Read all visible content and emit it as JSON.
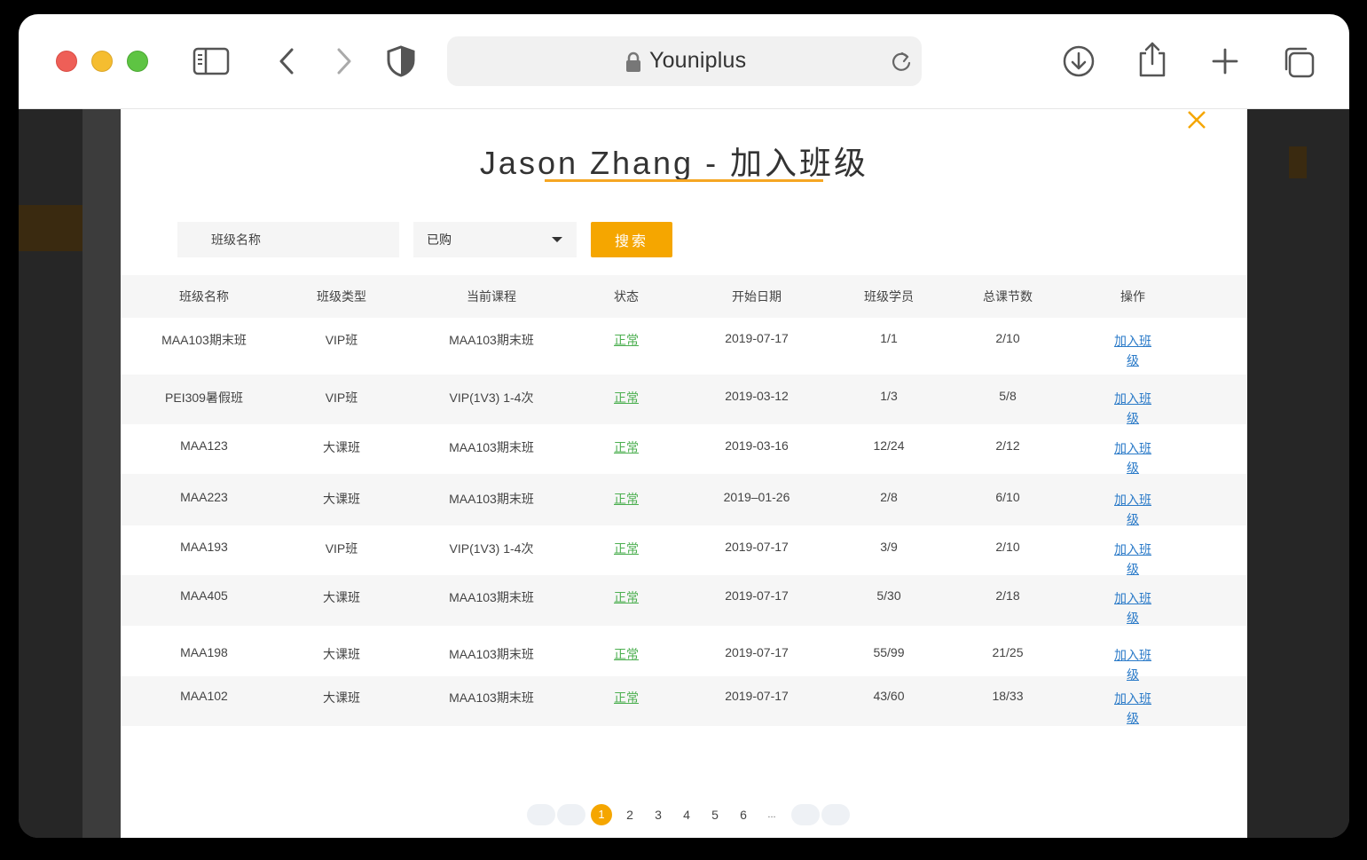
{
  "browser": {
    "address": "Youniplus"
  },
  "modal": {
    "title": "Jason Zhang - 加入班级",
    "search_placeholder": "班级名称",
    "select_value": "已购",
    "search_button": "搜索"
  },
  "table": {
    "headers": [
      "班级名称",
      "班级类型",
      "当前课程",
      "状态",
      "开始日期",
      "班级学员",
      "总课节数",
      "操作"
    ],
    "rows": [
      {
        "name": "MAA103期末班",
        "type": "VIP班",
        "course": "MAA103期末班",
        "status": "正常",
        "date": "2019-07-17",
        "students": "1/1",
        "lessons": "2/10",
        "action": "加入班级"
      },
      {
        "name": "PEI309暑假班",
        "type": "VIP班",
        "course": "VIP(1V3) 1-4次",
        "status": "正常",
        "date": "2019-03-12",
        "students": "1/3",
        "lessons": "5/8",
        "action": "加入班级"
      },
      {
        "name": "MAA123",
        "type": "大课班",
        "course": "MAA103期末班",
        "status": "正常",
        "date": "2019-03-16",
        "students": "12/24",
        "lessons": "2/12",
        "action": "加入班级"
      },
      {
        "name": "MAA223",
        "type": "大课班",
        "course": "MAA103期末班",
        "status": "正常",
        "date": "2019–01-26",
        "students": "2/8",
        "lessons": "6/10",
        "action": "加入班级"
      },
      {
        "name": "MAA193",
        "type": "VIP班",
        "course": "VIP(1V3) 1-4次",
        "status": "正常",
        "date": "2019-07-17",
        "students": "3/9",
        "lessons": "2/10",
        "action": "加入班级"
      },
      {
        "name": "MAA405",
        "type": "大课班",
        "course": "MAA103期末班",
        "status": "正常",
        "date": "2019-07-17",
        "students": "5/30",
        "lessons": "2/18",
        "action": "加入班级"
      },
      {
        "name": "MAA198",
        "type": "大课班",
        "course": "MAA103期末班",
        "status": "正常",
        "date": "2019-07-17",
        "students": "55/99",
        "lessons": "21/25",
        "action": "加入班级"
      },
      {
        "name": "MAA102",
        "type": "大课班",
        "course": "MAA103期末班",
        "status": "正常",
        "date": "2019-07-17",
        "students": "43/60",
        "lessons": "18/33",
        "action": "加入班级"
      }
    ]
  },
  "pagination": {
    "active": "1",
    "pages": [
      "2",
      "3",
      "4",
      "5",
      "6"
    ],
    "ellipsis": "..."
  },
  "colors": {
    "accent": "#f5a600",
    "status_green": "#4caf50",
    "link_blue": "#2a7ac8"
  }
}
